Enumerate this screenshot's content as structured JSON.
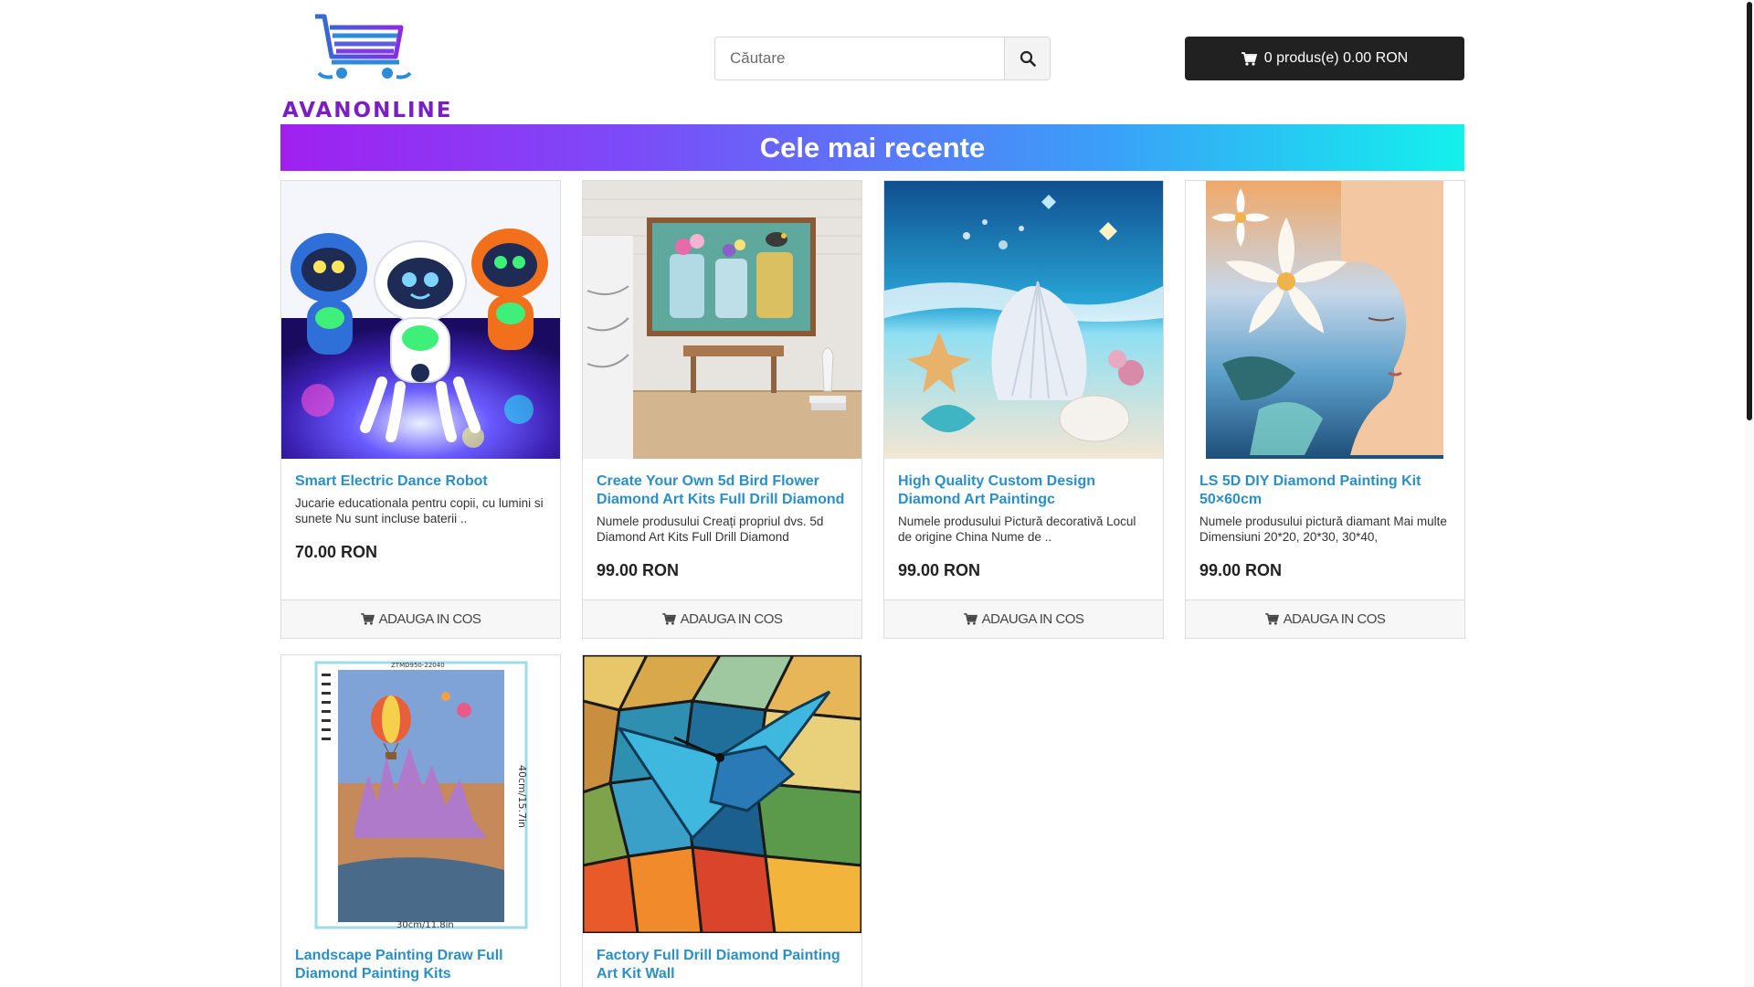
{
  "header": {
    "logo_text": "AVANONLINE",
    "search_placeholder": "Căutare",
    "cart_label": "0 produs(e) 0.00 RON"
  },
  "banner": {
    "title": "Cele mai recente"
  },
  "products": [
    {
      "title": "Smart Electric Dance Robot",
      "desc": "Jucarie educationala pentru copii, cu lumini si sunete Nu sunt incluse baterii  ..",
      "price": "70.00 RON",
      "add_label": "ADAUGA IN COS"
    },
    {
      "title": "Create Your Own 5d Bird Flower Diamond Art Kits Full Drill Diamond",
      "desc": "Numele produsului Creați propriul dvs. 5d Diamond Art Kits Full Drill Diamond",
      "price": "99.00 RON",
      "add_label": "ADAUGA IN COS"
    },
    {
      "title": "High Quality Custom Design Diamond Art Paintingc",
      "desc": "Numele produsului Pictură decorativă Locul de origine China Nume de ..",
      "price": "99.00 RON",
      "add_label": "ADAUGA IN COS"
    },
    {
      "title": "LS 5D DIY Diamond Painting Kit 50×60cm",
      "desc": "Numele produsului pictură diamant Mai multe Dimensiuni 20*20, 20*30, 30*40,",
      "price": "99.00 RON",
      "add_label": "ADAUGA IN COS"
    },
    {
      "title": "Landscape Painting Draw Full Diamond Painting Kits",
      "desc": "",
      "price": "",
      "add_label": "",
      "img_label_top": "ZTMD950-22040",
      "img_label_side": "40cm/15.7in",
      "img_label_bottom": "30cm/11.8in"
    },
    {
      "title": "Factory Full Drill Diamond Painting Art Kit Wall",
      "desc": "",
      "price": "",
      "add_label": ""
    }
  ],
  "icons": {
    "search": "search-icon",
    "cart": "cart-icon",
    "logo": "shopping-cart-logo-icon"
  }
}
